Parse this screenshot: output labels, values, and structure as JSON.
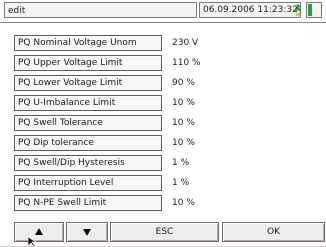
{
  "header": {
    "mode": "edit",
    "datetime": "06.09.2006 11:23:32"
  },
  "params": [
    {
      "label": "PQ Nominal Voltage Unom",
      "value": "230 V"
    },
    {
      "label": "PQ Upper Voltage Limit",
      "value": "110 %"
    },
    {
      "label": "PQ Lower Voltage Limit",
      "value": "90 %"
    },
    {
      "label": "PQ U-Imbalance Limit",
      "value": "10 %"
    },
    {
      "label": "PQ Swell Tolerance",
      "value": "10 %"
    },
    {
      "label": "PQ Dip tolerance",
      "value": "10 %"
    },
    {
      "label": "PQ Swell/Dip Hysteresis",
      "value": "1 %"
    },
    {
      "label": "PQ Interruption Level",
      "value": "1 %"
    },
    {
      "label": "PQ N-PE Swell Limit",
      "value": "10 %"
    }
  ],
  "buttons": {
    "up_icon": "arrow-up-icon",
    "down_icon": "arrow-down-icon",
    "esc": "ESC",
    "ok": "OK"
  },
  "colors": {
    "status_green": "#1fa63a",
    "icon_yellow": "#e8c21a"
  }
}
